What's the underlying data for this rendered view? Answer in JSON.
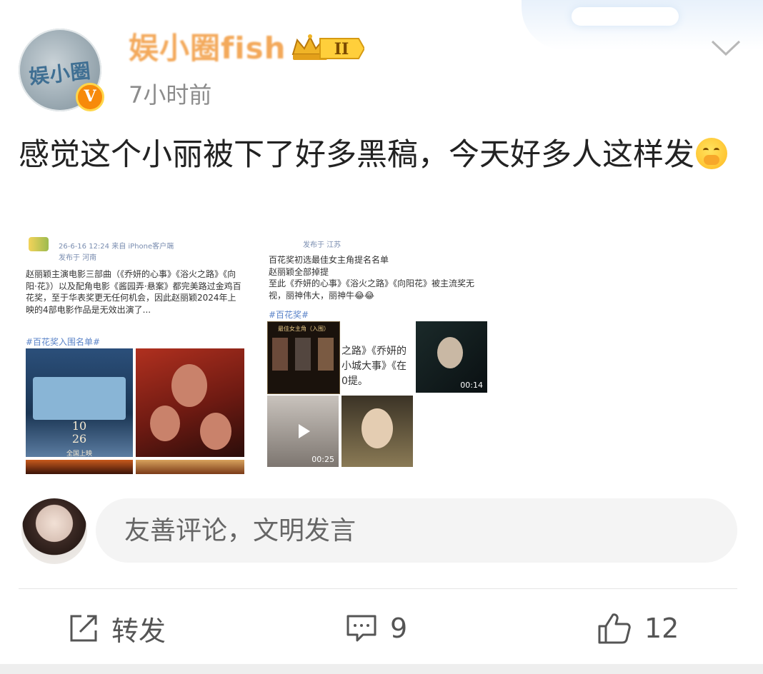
{
  "post": {
    "author": "娱小圈fish",
    "avatar_text": "娱小圈",
    "verified_badge": "V",
    "rank_badge": "II",
    "time": "7小时前",
    "text": "感觉这个小丽被下了好多黑稿，今天好多人这样发",
    "emoji_icon": "cover-mouth-crying-emoji"
  },
  "images": [
    {
      "meta_time": "26-6-16 12:24  来自 iPhone客户端",
      "meta_loc": "发布于 河南",
      "body": "赵丽颖主演电影三部曲（《乔妍的心事》《浴火之路》《向阳·花》）以及配角电影《酱园弄·悬案》都完美路过金鸡百花奖，至于华表奖更无任何机会，因此赵丽颖2024年上映的4部电影作品是无效出演了...",
      "tag": "#百花奖入围名单#",
      "poster_date": "10\n26",
      "poster_caption": "全国上映"
    },
    {
      "meta_loc": "发布于 江苏",
      "body": "百花奖初选最佳女主角提名名单\n赵丽颖全部掉提\n至此《乔妍的心事》《浴火之路》《向阳花》被主流奖无视，丽神伟大，丽神牛😂😂",
      "tag": "#百花奖#",
      "list_title": "最佳女主角（入围）",
      "overlay_text": "之路》《乔妍的\n小城大事》《在\n0提。",
      "duration_1": "00:14",
      "duration_2": "00:25"
    }
  ],
  "comment": {
    "placeholder": "友善评论，文明发言"
  },
  "actions": {
    "repost_label": "转发",
    "comment_count": "9",
    "like_count": "12"
  }
}
